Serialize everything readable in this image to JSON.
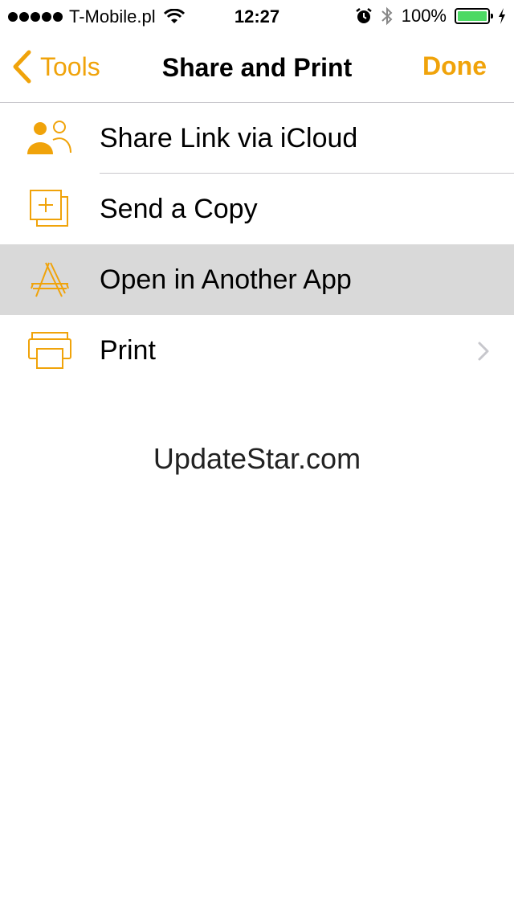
{
  "status_bar": {
    "carrier": "T-Mobile.pl",
    "time": "12:27",
    "battery_percent": "100%",
    "battery_level": 1.0,
    "battery_color": "#4cd964"
  },
  "nav": {
    "back_label": "Tools",
    "title": "Share and Print",
    "done_label": "Done",
    "accent_color": "#f0a30a"
  },
  "menu": {
    "items": [
      {
        "label": "Share Link via iCloud",
        "icon": "people-icon",
        "selected": false,
        "chevron": false
      },
      {
        "label": "Send a Copy",
        "icon": "copy-icon",
        "selected": false,
        "chevron": false
      },
      {
        "label": "Open in Another App",
        "icon": "app-store-icon",
        "selected": true,
        "chevron": false
      },
      {
        "label": "Print",
        "icon": "printer-icon",
        "selected": false,
        "chevron": true
      }
    ]
  },
  "watermark": "UpdateStar.com"
}
